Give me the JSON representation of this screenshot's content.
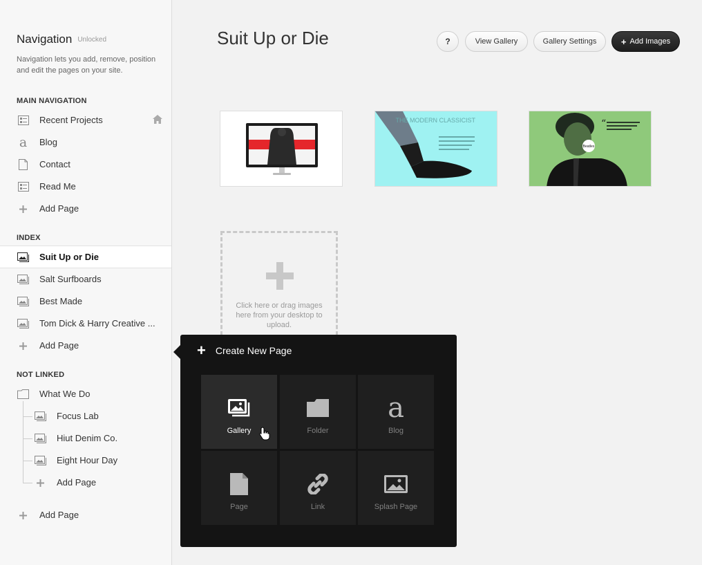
{
  "sidebar": {
    "title": "Navigation",
    "status_badge": "Unlocked",
    "description": "Navigation lets you add, remove, position and edit the pages on your site.",
    "sections": {
      "main": {
        "label": "MAIN NAVIGATION",
        "items": [
          "Recent Projects",
          "Blog",
          "Contact",
          "Read Me",
          "Add Page"
        ]
      },
      "index": {
        "label": "INDEX",
        "items": [
          "Suit Up or Die",
          "Salt Surfboards",
          "Best Made",
          "Tom Dick & Harry Creative ...",
          "Add Page"
        ]
      },
      "not_linked": {
        "label": "NOT LINKED",
        "folder": "What We Do",
        "children": [
          "Focus Lab",
          "Hiut Denim Co.",
          "Eight Hour Day",
          "Add Page"
        ],
        "bottom_add": "Add Page"
      }
    }
  },
  "header": {
    "title": "Suit Up or Die",
    "help_label": "?",
    "view_gallery": "View Gallery",
    "gallery_settings": "Gallery Settings",
    "add_images": "Add Images"
  },
  "thumbnails": {
    "thumb2_text": "THE MODERN CLASSICIST",
    "thumb3_badge": "Beatles"
  },
  "upload": {
    "text": "Click here or drag images here from your desktop to upload."
  },
  "popover": {
    "title": "Create New Page",
    "tiles": [
      "Gallery",
      "Folder",
      "Blog",
      "Page",
      "Link",
      "Splash Page"
    ]
  },
  "colors": {
    "accent_dark": "#1e1e1e",
    "popover_bg": "#141414",
    "thumb2_bg": "#9ff2f2",
    "thumb3_bg": "#8fc97b",
    "thumb1_red": "#e5262b"
  }
}
